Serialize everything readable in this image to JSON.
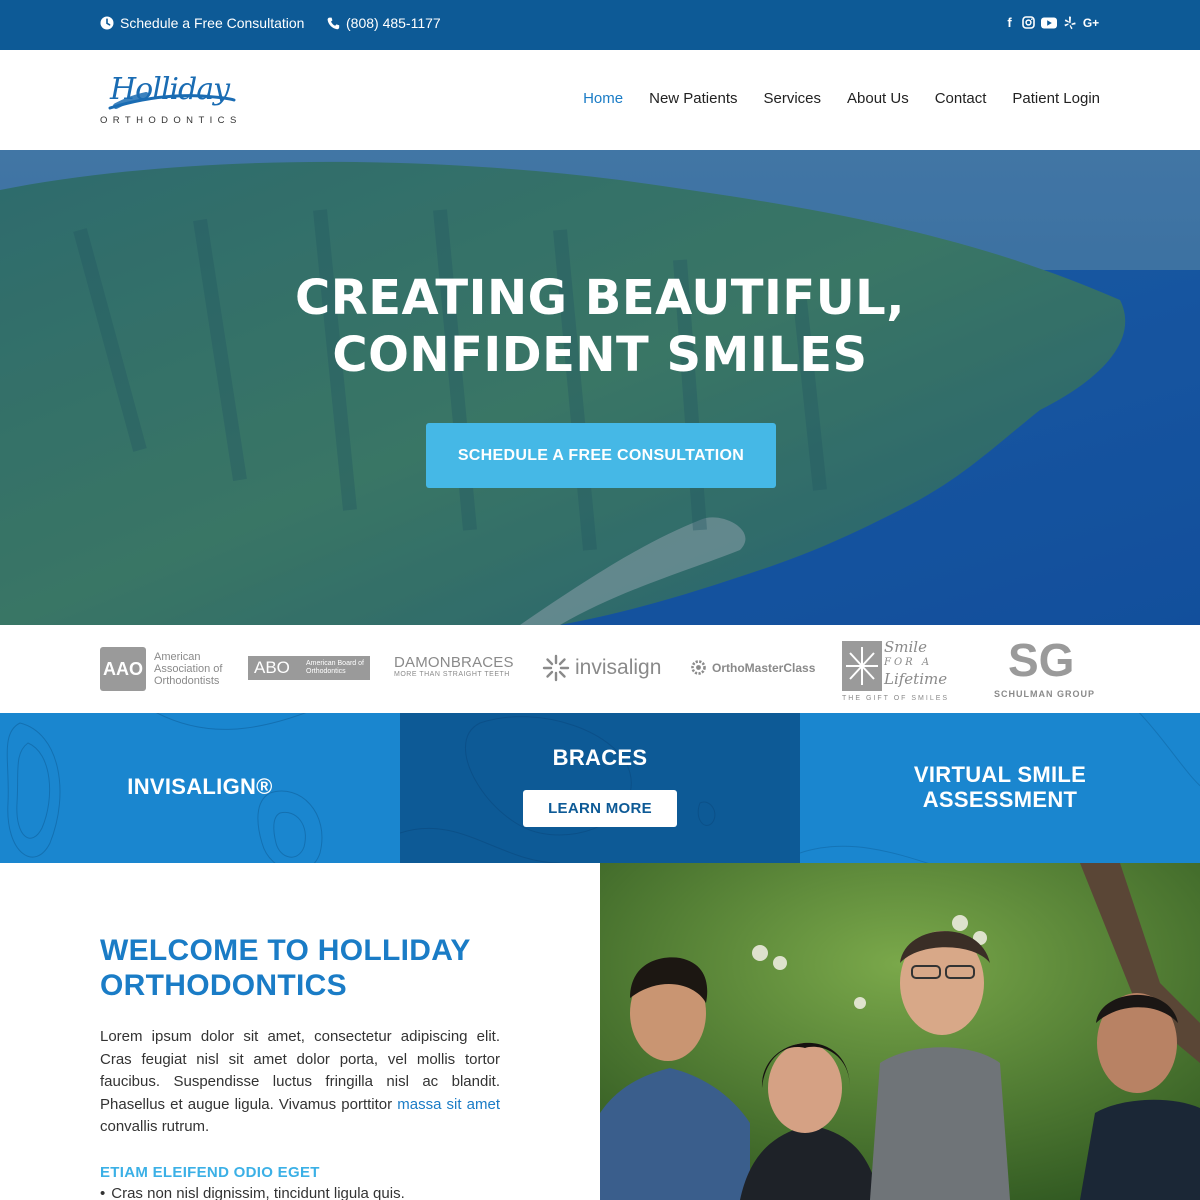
{
  "topbar": {
    "schedule_label": "Schedule a Free Consultation",
    "phone": "(808) 485-1177",
    "social_icons": [
      "facebook-icon",
      "instagram-icon",
      "youtube-icon",
      "yelp-icon",
      "google-plus-icon"
    ]
  },
  "header": {
    "logo_script": "Holliday",
    "logo_sub": "ORTHODONTICS",
    "nav": [
      {
        "label": "Home",
        "active": true
      },
      {
        "label": "New Patients",
        "active": false
      },
      {
        "label": "Services",
        "active": false
      },
      {
        "label": "About Us",
        "active": false
      },
      {
        "label": "Contact",
        "active": false
      },
      {
        "label": "Patient Login",
        "active": false
      }
    ]
  },
  "hero": {
    "title_line1": "CREATING BEAUTIFUL,",
    "title_line2": "CONFIDENT SMILES",
    "cta": "SCHEDULE A FREE CONSULTATION"
  },
  "affiliations": {
    "aac_mark": "AAO",
    "aac_text_1": "American",
    "aac_text_2": "Association of",
    "aac_text_3": "Orthodontists",
    "abo_mark": "ABO",
    "abo_text": "American Board of Orthodontics",
    "damon": "DAMONBRACES",
    "damon_sub": "MORE THAN STRAIGHT TEETH",
    "invisalign": "invisalign",
    "omc": "OrthoMasterClass",
    "sfl_line1": "Smile",
    "sfl_line2": "FOR A",
    "sfl_line3": "Lifetime",
    "sfl_sub": "THE GIFT OF SMILES",
    "sg_mark": "SG",
    "sg_text": "SCHULMAN GROUP"
  },
  "tiles": {
    "invisalign": "INVISALIGN®",
    "braces": "BRACES",
    "learn_more": "LEARN MORE",
    "virtual_line1": "VIRTUAL SMILE",
    "virtual_line2": "ASSESSMENT"
  },
  "welcome": {
    "title_line1": "WELCOME TO HOLLIDAY",
    "title_line2": "ORTHODONTICS",
    "body_text": "Lorem ipsum dolor sit amet, consectetur adipiscing elit. Cras feugiat nisl sit amet dolor porta, vel mollis tortor faucibus. Suspendisse luctus fringilla nisl ac blandit. Phasellus et augue ligula. Vivamus porttitor ",
    "body_link": "massa sit amet",
    "body_tail": " convallis rutrum.",
    "subheading": "ETIAM ELEIFEND ODIO EGET",
    "bullet_1": "Cras non nisl dignissim, tincidunt ligula quis."
  },
  "colors": {
    "primary_dark": "#0d5a96",
    "primary": "#1a86cf",
    "accent": "#45b8e6",
    "link": "#1a7cc6"
  }
}
